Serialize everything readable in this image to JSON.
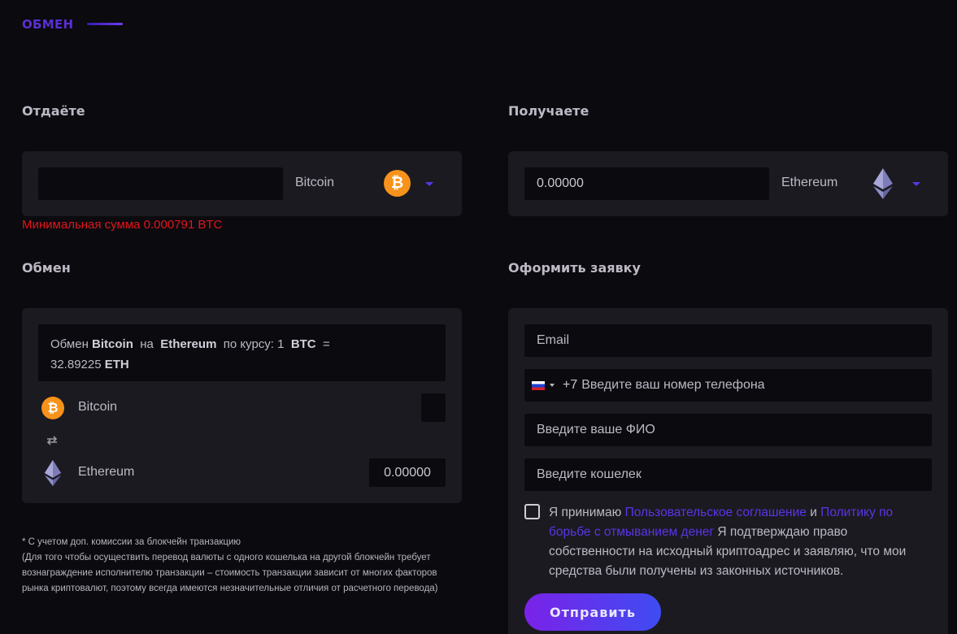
{
  "header": {
    "title": "ОБМЕН"
  },
  "give": {
    "label": "Отдаёте",
    "amount_value": "",
    "currency": "Bitcoin",
    "icon": "bitcoin-icon",
    "error": "Минимальная сумма 0.000791 BTC"
  },
  "receive": {
    "label": "Получаете",
    "amount_value": "0.00000",
    "currency": "Ethereum",
    "icon": "ethereum-icon"
  },
  "exchange": {
    "label": "Обмен",
    "rate": {
      "prefix": "Обмен",
      "from": "Bitcoin",
      "on": "на",
      "to": "Ethereum",
      "by_rate": "по курсу: 1",
      "from_code": "BTC",
      "eq": "=",
      "value": "32.89225",
      "to_code": "ETH"
    },
    "from_row": {
      "name": "Bitcoin",
      "value": ""
    },
    "to_row": {
      "name": "Ethereum",
      "value": "0.00000"
    }
  },
  "notes": {
    "line1": "* С учетом доп. комиссии за блокчейн транзакцию",
    "line2": "(Для того чтобы осуществить перевод валюты с одного кошелька на другой блокчейн требует",
    "line3": "вознаграждение исполнителю транзакции – стоимость транзакции зависит от многих факторов",
    "line4": "рынка криптовалют, поэтому всегда имеются незначительные отличия от расчетного перевода)"
  },
  "order": {
    "label": "Оформить заявку",
    "email_placeholder": "Email",
    "phone_code": "+7",
    "phone_placeholder": "Введите ваш номер телефона",
    "name_placeholder": "Введите ваше ФИО",
    "wallet_placeholder": "Введите кошелек",
    "consent": {
      "pre": "Я принимаю",
      "link1": "Пользовательское соглашение",
      "and": "и",
      "link2": "Политику по борьбе с отмыванием денег",
      "post": "Я подтверждаю право собственности на исходный криптоадрес и заявляю, что мои средства были получены из законных источников."
    },
    "submit": "Отправить"
  },
  "colors": {
    "accent": "#5a35e6",
    "error": "#e0161b",
    "bitcoin": "#f7931a",
    "background": "#0b0a0f",
    "card": "#1b1a21"
  }
}
